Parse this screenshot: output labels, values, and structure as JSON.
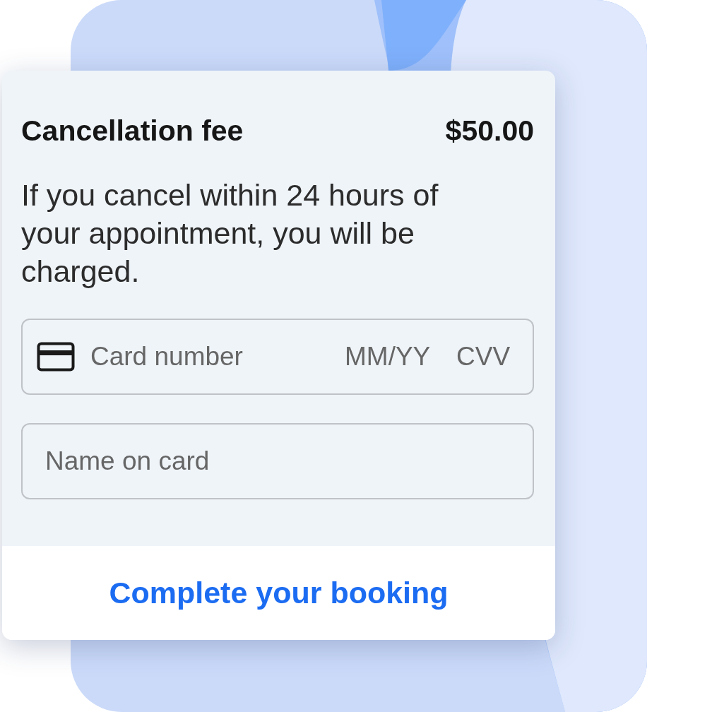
{
  "fee": {
    "label": "Cancellation fee",
    "amount": "$50.00"
  },
  "description": "If you cancel within 24 hours of your appointment, you will be charged.",
  "card_field": {
    "placeholder": "Card number",
    "expiry_placeholder": "MM/YY",
    "cvv_placeholder": "CVV"
  },
  "name_field": {
    "placeholder": "Name on card"
  },
  "button": {
    "label": "Complete your booking"
  }
}
